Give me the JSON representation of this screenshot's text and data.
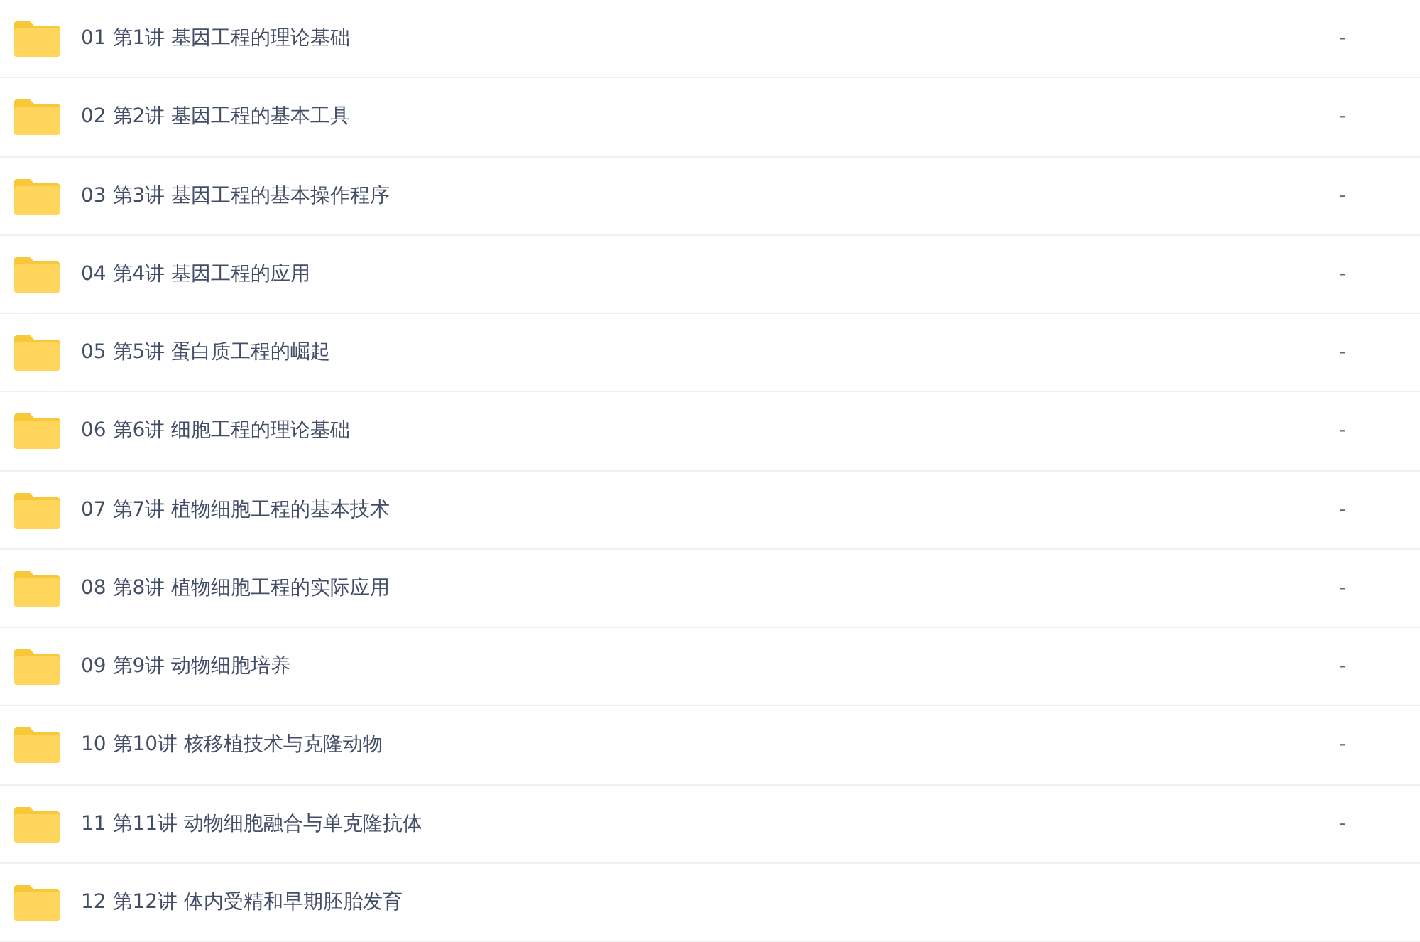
{
  "files": [
    {
      "name": "01 第1讲 基因工程的理论基础",
      "size": "-"
    },
    {
      "name": "02 第2讲 基因工程的基本工具",
      "size": "-"
    },
    {
      "name": "03 第3讲 基因工程的基本操作程序",
      "size": "-"
    },
    {
      "name": "04 第4讲 基因工程的应用",
      "size": "-"
    },
    {
      "name": "05 第5讲 蛋白质工程的崛起",
      "size": "-"
    },
    {
      "name": "06 第6讲 细胞工程的理论基础",
      "size": "-"
    },
    {
      "name": "07 第7讲 植物细胞工程的基本技术",
      "size": "-"
    },
    {
      "name": "08 第8讲 植物细胞工程的实际应用",
      "size": "-"
    },
    {
      "name": "09 第9讲 动物细胞培养",
      "size": "-"
    },
    {
      "name": "10 第10讲 核移植技术与克隆动物",
      "size": "-"
    },
    {
      "name": "11 第11讲 动物细胞融合与单克隆抗体",
      "size": "-"
    },
    {
      "name": "12 第12讲 体内受精和早期胚胎发育"
    }
  ]
}
